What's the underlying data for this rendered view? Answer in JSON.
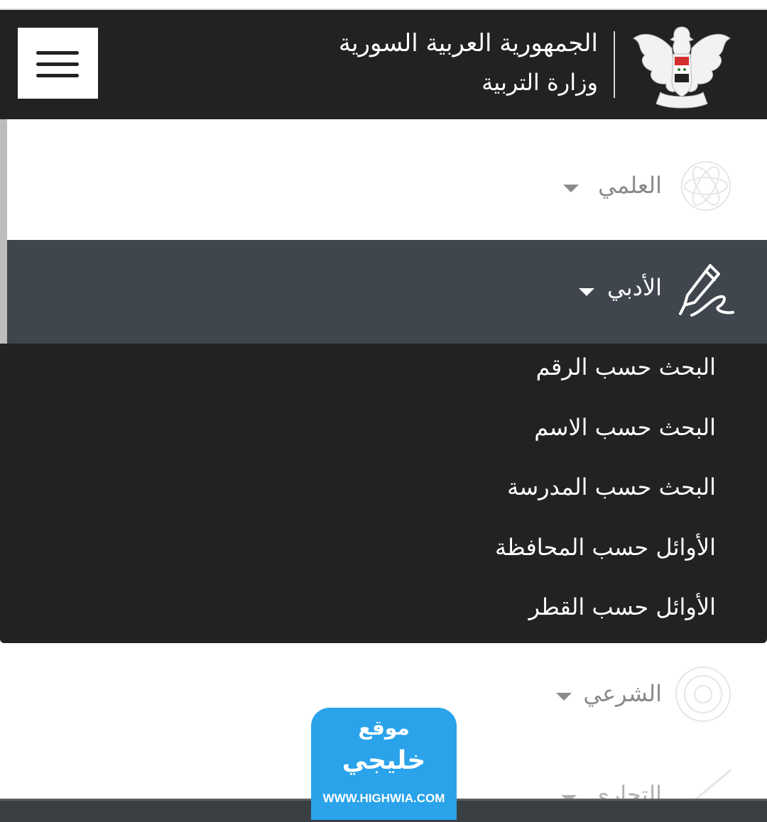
{
  "header": {
    "title_line1": "الجمهورية العربية السورية",
    "title_line2": "وزارة التربية",
    "menu_icon": "hamburger-menu-icon",
    "emblem_icon": "syrian-eagle-emblem-icon"
  },
  "sections": {
    "scientific": {
      "label": "العلمي",
      "icon": "atom-icon"
    },
    "literary": {
      "label": "الأدبي",
      "icon": "pen-signature-icon"
    },
    "sharia": {
      "label": "الشرعي",
      "icon": "ornament-icon"
    },
    "commercial": {
      "label": "التجاري",
      "icon": "pen-icon"
    }
  },
  "submenu": {
    "items": [
      "البحث حسب الرقم",
      "البحث حسب الاسم",
      "البحث حسب المدرسة",
      "الأوائل حسب المحافظة",
      "الأوائل حسب القطر"
    ]
  },
  "badge": {
    "line1": "موقع",
    "line2": "خليجي",
    "line3": "WWW.HIGHWIA.COM"
  },
  "colors": {
    "header_bg": "#222222",
    "active_section_bg": "#3f464d",
    "submenu_bg": "#222222",
    "badge_bg": "#2aa3ea"
  }
}
